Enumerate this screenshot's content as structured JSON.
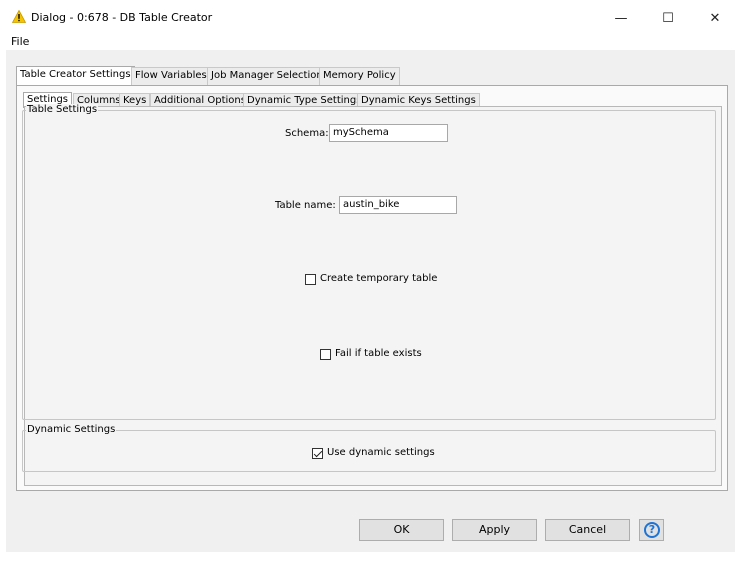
{
  "window": {
    "title": "Dialog - 0:678 - DB Table Creator",
    "minimize_glyph": "—",
    "maximize_glyph": "☐",
    "close_glyph": "✕",
    "title_icon": "warning-icon",
    "title_icon_color": "#f5c400"
  },
  "menu": {
    "file_label": "File"
  },
  "outer_tabs": [
    {
      "label": "Table Creator Settings",
      "active": true
    },
    {
      "label": "Flow Variables",
      "active": false
    },
    {
      "label": "Job Manager Selection",
      "active": false
    },
    {
      "label": "Memory Policy",
      "active": false
    }
  ],
  "inner_tabs": [
    {
      "label": "Settings",
      "active": true
    },
    {
      "label": "Columns",
      "active": false
    },
    {
      "label": "Keys",
      "active": false
    },
    {
      "label": "Additional Options",
      "active": false
    },
    {
      "label": "Dynamic Type Settings",
      "active": false
    },
    {
      "label": "Dynamic Keys Settings",
      "active": false
    }
  ],
  "table_settings": {
    "group_title": "Table Settings",
    "schema_label": "Schema:",
    "schema_value": "mySchema",
    "table_name_label": "Table name:",
    "table_name_value": "austin_bike",
    "create_temp_label": "Create temporary table",
    "create_temp_checked": false,
    "fail_if_exists_label": "Fail if table exists",
    "fail_if_exists_checked": false
  },
  "dynamic_settings": {
    "group_title": "Dynamic Settings",
    "use_dynamic_label": "Use dynamic settings",
    "use_dynamic_checked": true
  },
  "buttons": {
    "ok_label": "OK",
    "apply_label": "Apply",
    "cancel_label": "Cancel",
    "help_glyph": "?",
    "help_color": "#1e74d6"
  }
}
